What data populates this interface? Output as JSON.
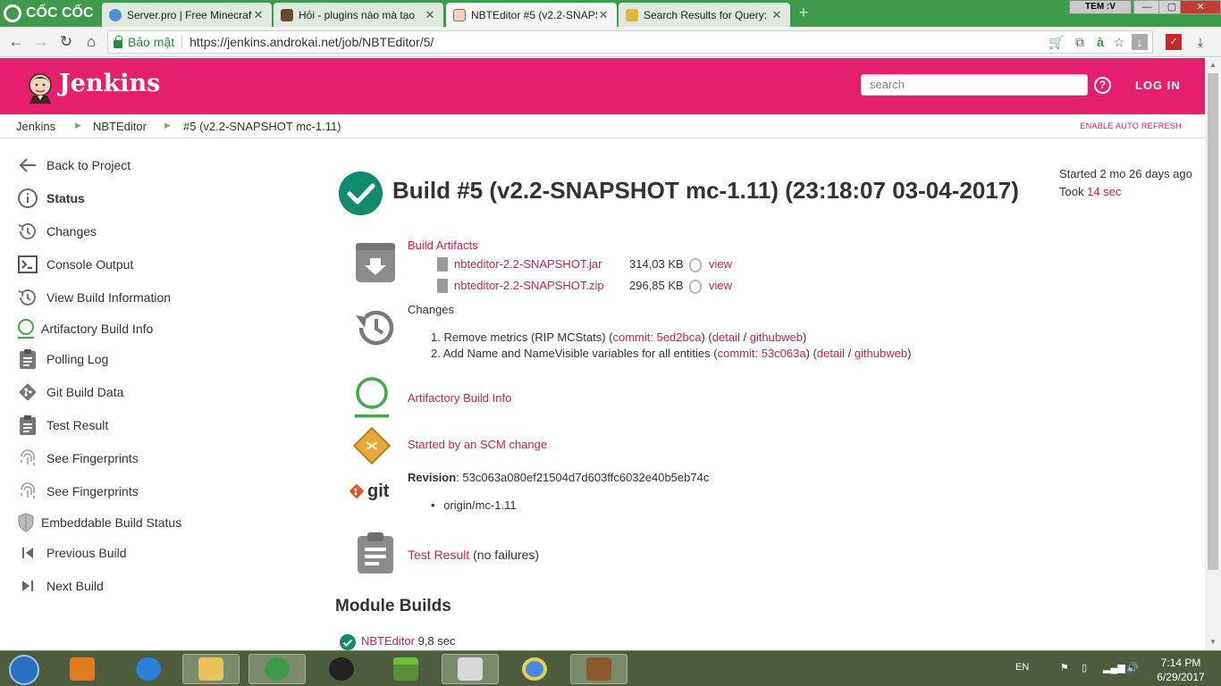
{
  "browser": {
    "brand": "CỐC CỐC",
    "tabs": [
      {
        "label": "Server.pro | Free Minecraft",
        "active": false
      },
      {
        "label": "Hỏi - plugins nào mà tạo",
        "active": false
      },
      {
        "label": "NBTEditor #5 (v2.2-SNAPS",
        "active": true
      },
      {
        "label": "Search Results for Query:",
        "active": false
      }
    ],
    "window_badge": "TEM :V",
    "secure_label": "Bảo mật",
    "url": "https://jenkins.androkai.net/job/NBTEditor/5/"
  },
  "header": {
    "title": "Jenkins",
    "search_placeholder": "search",
    "help": "?",
    "login": "LOG IN"
  },
  "breadcrumb": {
    "items": [
      "Jenkins",
      "NBTEditor",
      "#5 (v2.2-SNAPSHOT mc-1.11)"
    ],
    "auto_refresh": "ENABLE AUTO REFRESH"
  },
  "sidebar": {
    "items": [
      {
        "label": "Back to Project",
        "icon": "arrow-left-icon"
      },
      {
        "label": "Status",
        "icon": "info-icon"
      },
      {
        "label": "Changes",
        "icon": "history-icon"
      },
      {
        "label": "Console Output",
        "icon": "terminal-icon"
      },
      {
        "label": "View Build Information",
        "icon": "history-icon"
      },
      {
        "label": "Artifactory Build Info",
        "icon": "artifactory-icon"
      },
      {
        "label": "Polling Log",
        "icon": "clipboard-icon"
      },
      {
        "label": "Git Build Data",
        "icon": "git-icon"
      },
      {
        "label": "Test Result",
        "icon": "clipboard-icon"
      },
      {
        "label": "See Fingerprints",
        "icon": "fingerprint-icon"
      },
      {
        "label": "See Fingerprints",
        "icon": "fingerprint-icon"
      },
      {
        "label": "Embeddable Build Status",
        "icon": "shield-icon"
      },
      {
        "label": "Previous Build",
        "icon": "previous-icon"
      },
      {
        "label": "Next Build",
        "icon": "next-icon"
      }
    ]
  },
  "build": {
    "title": "Build #5 (v2.2-SNAPSHOT mc-1.11) (23:18:07 03-04-2017)",
    "started": "Started 2 mo 26 days ago",
    "took_prefix": "Took",
    "took_value": "14 sec",
    "artifacts_label": "Build Artifacts",
    "artifacts": [
      {
        "name": "nbteditor-2.2-SNAPSHOT.jar",
        "size": "314,03 KB",
        "action": "view"
      },
      {
        "name": "nbteditor-2.2-SNAPSHOT.zip",
        "size": "296,85 KB",
        "action": "view"
      }
    ],
    "changes_label": "Changes",
    "changes": [
      {
        "num": "1.",
        "text": "Remove metrics (RIP MCStats) (",
        "commit": "commit: 5ed2bca",
        "mid": ") (",
        "detail": "detail",
        "slash": " / ",
        "web": "githubweb",
        "end": ")"
      },
      {
        "num": "2.",
        "text": "Add Name and NameVisible variables for all entities (",
        "commit": "commit: 53c063a",
        "mid": ") (",
        "detail": "detail",
        "slash": " / ",
        "web": "githubweb",
        "end": ")"
      }
    ],
    "artifactory_label": "Artifactory Build Info",
    "scm_label": "Started by an SCM change",
    "revision_label": "Revision",
    "revision_value": ": 53c063a080ef21504d7d603ffc6032e40b5eb74c",
    "branch": "origin/mc-1.11",
    "git_text": "git",
    "test_result_label": "Test Result",
    "test_result_note": " (no failures)",
    "module_heading": "Module Builds",
    "module_name": "NBTEditor",
    "module_time": " 9,8 sec"
  },
  "taskbar": {
    "lang": "EN",
    "time": "7:14 PM",
    "date": "6/29/2017"
  },
  "colors": {
    "jenkins_pink": "#e51e6e",
    "link_red": "#d2204e",
    "success_green": "#138a6e",
    "browser_green": "#3f9a4b"
  }
}
